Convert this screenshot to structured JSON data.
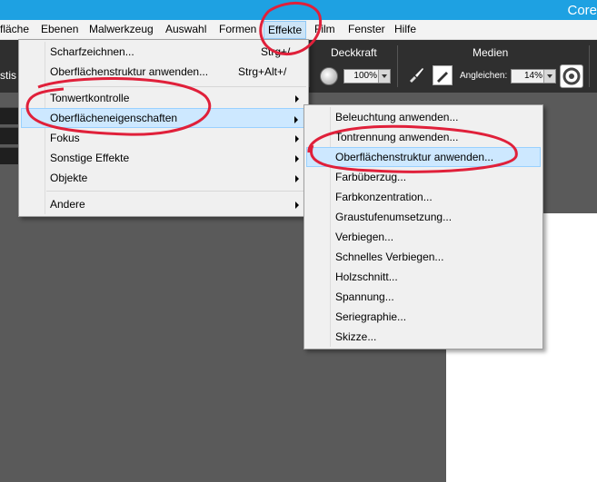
{
  "window": {
    "title_partial": "Core"
  },
  "menubar": {
    "items": [
      "fläche",
      "Ebenen",
      "Malwerkzeug",
      "Auswahl",
      "Formen",
      "Effekte",
      "Film",
      "Fenster",
      "Hilfe"
    ]
  },
  "toolbar": {
    "left_label_partial": "stis",
    "opacity_label": "Deckkraft",
    "opacity_value": "100%",
    "media_label": "Medien",
    "blend_label": "Angleichen:",
    "blend_value": "14%"
  },
  "effects_menu": {
    "items": [
      {
        "label": "Scharfzeichnen...",
        "shortcut": "Strg+/"
      },
      {
        "label": "Oberflächenstruktur anwenden...",
        "shortcut": "Strg+Alt+/"
      },
      {
        "label": "Tonwertkontrolle"
      },
      {
        "label": "Oberflächeneigenschaften"
      },
      {
        "label": "Fokus"
      },
      {
        "label": "Sonstige Effekte"
      },
      {
        "label": "Objekte"
      },
      {
        "label": "Andere"
      }
    ]
  },
  "submenu": {
    "items": [
      "Beleuchtung anwenden...",
      "Tontrennung anwenden...",
      "Oberflächenstruktur anwenden...",
      "Farbüberzug...",
      "Farbkonzentration...",
      "Graustufenumsetzung...",
      "Verbiegen...",
      "Schnelles Verbiegen...",
      "Holzschnitt...",
      "Spannung...",
      "Seriegraphie...",
      "Skizze..."
    ]
  },
  "colors": {
    "titlebar": "#1ea1e2",
    "highlight": "#cde8ff",
    "annotation": "#e0203a"
  }
}
